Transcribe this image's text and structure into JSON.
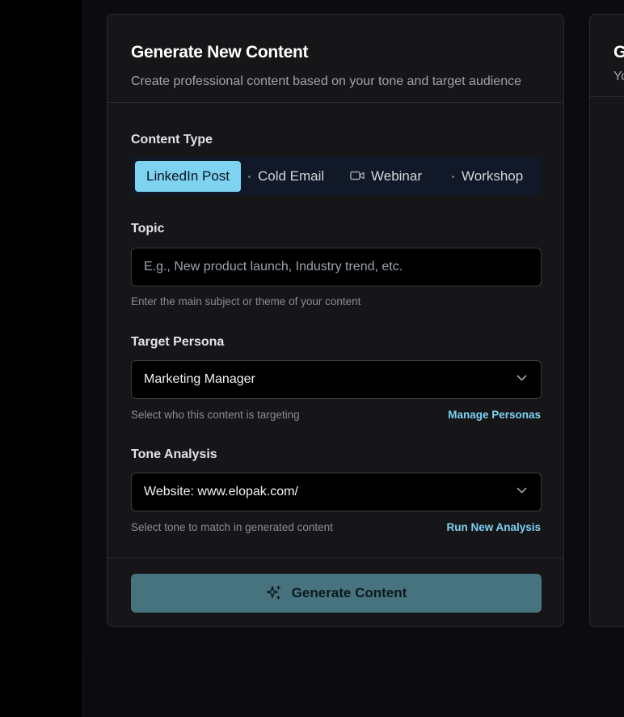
{
  "card": {
    "title": "Generate New Content",
    "subtitle": "Create professional content based on your tone and target audience"
  },
  "content_type": {
    "label": "Content Type",
    "tabs": [
      {
        "label": "LinkedIn Post",
        "icon": "none",
        "active": true
      },
      {
        "label": "Cold Email",
        "icon": "dot-icon",
        "active": false
      },
      {
        "label": "Webinar",
        "icon": "video-icon",
        "active": false
      },
      {
        "label": "Workshop",
        "icon": "dot-icon",
        "active": false
      }
    ]
  },
  "topic": {
    "label": "Topic",
    "placeholder": "E.g., New product launch, Industry trend, etc.",
    "value": "",
    "helper": "Enter the main subject or theme of your content"
  },
  "persona": {
    "label": "Target Persona",
    "selected": "Marketing Manager",
    "helper": "Select who this content is targeting",
    "link": "Manage Personas"
  },
  "tone": {
    "label": "Tone Analysis",
    "selected": "Website: www.elopak.com/",
    "helper": "Select tone to match in generated content",
    "link": "Run New Analysis"
  },
  "generate_button": {
    "label": "Generate Content",
    "icon": "sparkles-icon"
  },
  "side_card": {
    "title_partial": "G",
    "subtitle_partial": "Yo"
  },
  "colors": {
    "accent": "#7dd3f0",
    "button_bg": "#46737e",
    "card_bg": "#161619",
    "page_bg": "#000000"
  }
}
